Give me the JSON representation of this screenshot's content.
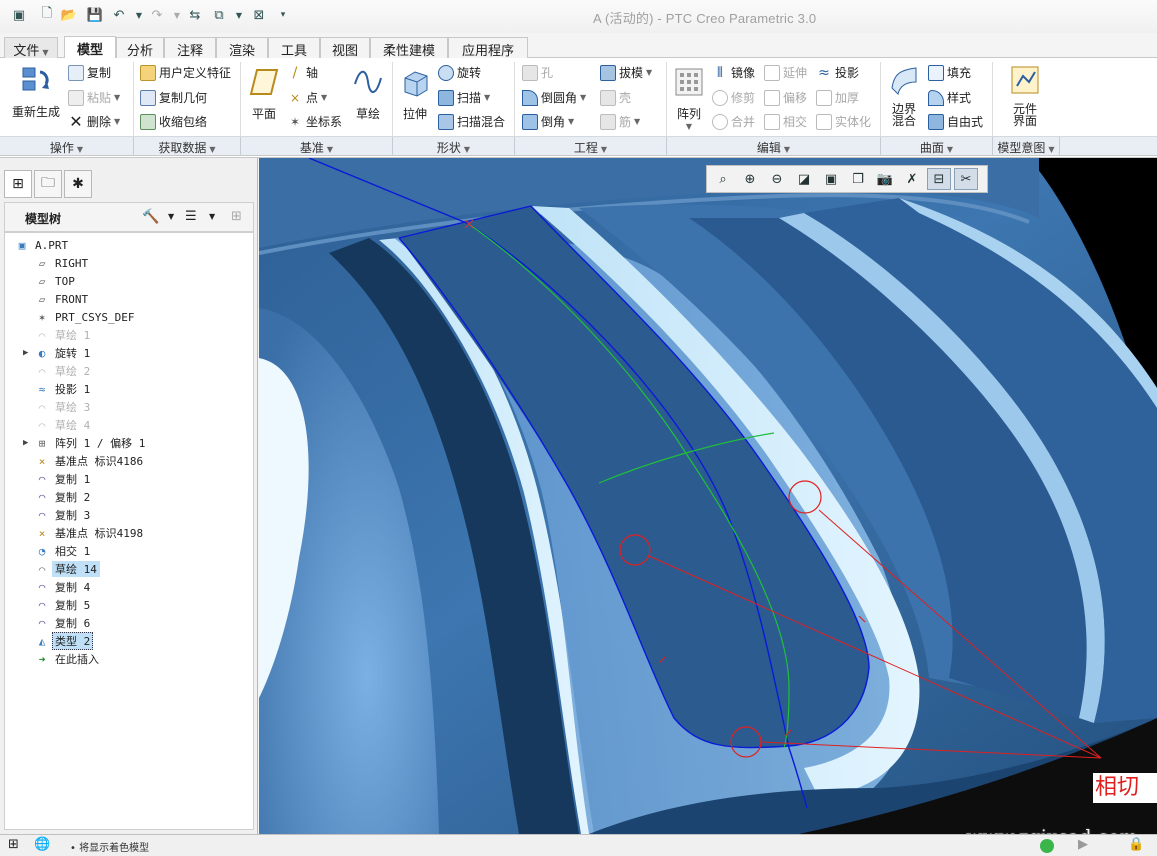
{
  "window": {
    "title": "A (活动的) - PTC Creo Parametric 3.0"
  },
  "menu_tabs": [
    {
      "label": "文件",
      "caret": "▼"
    },
    {
      "label": "模型"
    },
    {
      "label": "分析"
    },
    {
      "label": "注释"
    },
    {
      "label": "渲染"
    },
    {
      "label": "工具"
    },
    {
      "label": "视图"
    },
    {
      "label": "柔性建模"
    },
    {
      "label": "应用程序"
    }
  ],
  "ribbon": {
    "regenerate": "重新生成",
    "copy": "复制",
    "paste": "粘贴",
    "delete": "删除",
    "udf": "用户定义特征",
    "copy_geometry": "复制几何",
    "shrinkwrap": "收缩包络",
    "plane": "平面",
    "axis": "轴",
    "point": "点",
    "csys": "坐标系",
    "sketch": "草绘",
    "extrude": "拉伸",
    "revolve": "旋转",
    "sweep": "扫描",
    "swept_blend": "扫描混合",
    "hole": "孔",
    "round": "倒圆角",
    "chamfer": "倒角",
    "draft": "拔模",
    "shell": "壳",
    "rib": "筋",
    "pattern": "阵列",
    "mirror": "镜像",
    "trim": "修剪",
    "merge": "合并",
    "extend": "延伸",
    "offset": "偏移",
    "intersect": "相交",
    "project": "投影",
    "thicken": "加厚",
    "solidify": "实体化",
    "boundary_blend": "边界\n混合",
    "fill": "填充",
    "style": "样式",
    "freestyle": "自由式",
    "component_interface": "元件\n界面"
  },
  "ribbon_groups": [
    {
      "label": "操作"
    },
    {
      "label": "获取数据"
    },
    {
      "label": "基准"
    },
    {
      "label": "形状"
    },
    {
      "label": "工程"
    },
    {
      "label": "编辑"
    },
    {
      "label": "曲面"
    },
    {
      "label": "模型意图"
    }
  ],
  "model_tree": {
    "title": "模型树",
    "nodes": [
      {
        "label": "A.PRT",
        "icon": "part-icon",
        "state": "normal"
      },
      {
        "label": "RIGHT",
        "icon": "datum-plane-icon",
        "state": "normal"
      },
      {
        "label": "TOP",
        "icon": "datum-plane-icon",
        "state": "normal"
      },
      {
        "label": "FRONT",
        "icon": "datum-plane-icon",
        "state": "normal"
      },
      {
        "label": "PRT_CSYS_DEF",
        "icon": "csys-icon",
        "state": "normal"
      },
      {
        "label": "草绘 1",
        "icon": "sketch-icon",
        "state": "dim"
      },
      {
        "label": "旋转 1",
        "icon": "revolve-icon",
        "state": "normal",
        "expandable": true
      },
      {
        "label": "草绘 2",
        "icon": "sketch-icon",
        "state": "dim"
      },
      {
        "label": "投影 1",
        "icon": "project-icon",
        "state": "normal"
      },
      {
        "label": "草绘 3",
        "icon": "sketch-icon",
        "state": "dim"
      },
      {
        "label": "草绘 4",
        "icon": "sketch-icon",
        "state": "dim"
      },
      {
        "label": "阵列 1 / 偏移 1",
        "icon": "pattern-icon",
        "state": "normal",
        "expandable": true
      },
      {
        "label": "基准点 标识4186",
        "icon": "datum-point-icon",
        "state": "normal"
      },
      {
        "label": "复制 1",
        "icon": "copy-surface-icon",
        "state": "normal"
      },
      {
        "label": "复制 2",
        "icon": "copy-surface-icon",
        "state": "normal"
      },
      {
        "label": "复制 3",
        "icon": "copy-surface-icon",
        "state": "normal"
      },
      {
        "label": "基准点 标识4198",
        "icon": "datum-point-icon",
        "state": "normal"
      },
      {
        "label": "相交 1",
        "icon": "intersect-icon",
        "state": "normal"
      },
      {
        "label": "草绘 14",
        "icon": "sketch-icon",
        "state": "highlight"
      },
      {
        "label": "复制 4",
        "icon": "copy-surface-icon",
        "state": "normal"
      },
      {
        "label": "复制 5",
        "icon": "copy-surface-icon",
        "state": "normal"
      },
      {
        "label": "复制 6",
        "icon": "copy-surface-icon",
        "state": "normal"
      },
      {
        "label": "类型 2",
        "icon": "boundary-blend-icon",
        "state": "selected"
      },
      {
        "label": "在此插入",
        "icon": "insert-arrow-icon",
        "state": "normal"
      }
    ]
  },
  "viewport": {
    "annotation": "相切",
    "watermark": "www.zgjxcad.com"
  },
  "status": {
    "message": "• 将显示着色模型"
  },
  "colors": {
    "accent": "#1f6fb5",
    "annotation_red": "#e02020",
    "curve_blue": "#0a1ad8",
    "curve_green": "#1fbf3a",
    "selection": "#bfe0f7"
  }
}
